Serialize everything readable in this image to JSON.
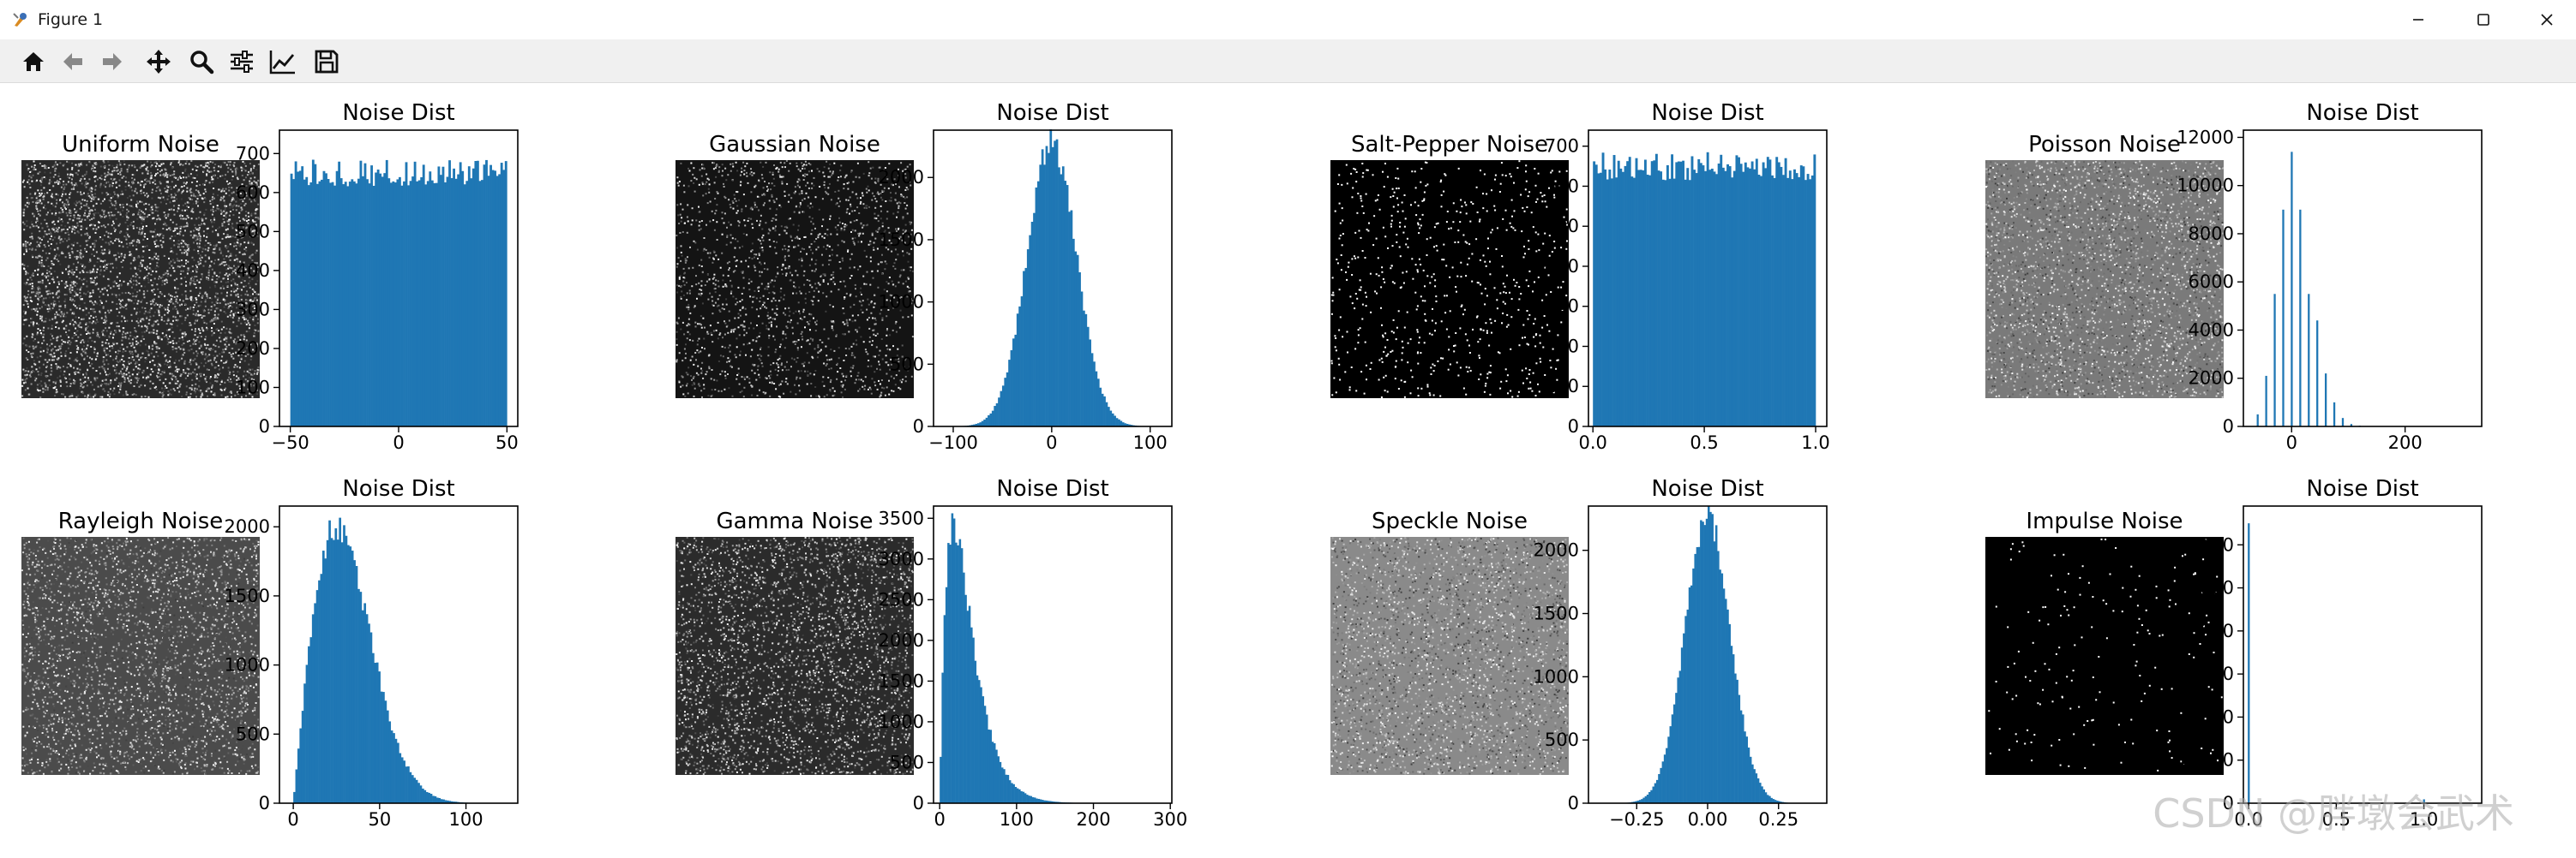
{
  "window": {
    "title": "Figure 1",
    "minimize_icon": "minimize-icon",
    "maximize_icon": "maximize-icon",
    "close_icon": "close-icon"
  },
  "toolbar": {
    "tools": [
      {
        "name": "home-icon"
      },
      {
        "name": "back-arrow-icon"
      },
      {
        "name": "forward-arrow-icon"
      },
      {
        "name": "pan-move-icon"
      },
      {
        "name": "zoom-icon"
      },
      {
        "name": "configure-subplots-icon"
      },
      {
        "name": "edit-axis-icon"
      },
      {
        "name": "save-icon"
      }
    ]
  },
  "colors": {
    "bar": "#1f77b4"
  },
  "watermark": "CSDN @胖墩会武术",
  "chart_data": [
    {
      "type": "image",
      "title": "Uniform Noise",
      "intensity": "mixed-black-white"
    },
    {
      "type": "bar",
      "title": "Noise Dist",
      "x_ticks": [
        "−50",
        "0",
        "50"
      ],
      "y_ticks": [
        "0",
        "100",
        "200",
        "300",
        "400",
        "500",
        "600",
        "700"
      ],
      "xlim": [
        -55,
        55
      ],
      "ylim": [
        0,
        760
      ],
      "series": [
        {
          "shape": "uniform",
          "x_range": [
            -50,
            50
          ],
          "mean_height": 650,
          "noise": 35
        }
      ]
    },
    {
      "type": "image",
      "title": "Gaussian Noise",
      "intensity": "dark-sparse"
    },
    {
      "type": "bar",
      "title": "Noise Dist",
      "x_ticks": [
        "−100",
        "0",
        "100"
      ],
      "y_ticks": [
        "0",
        "500",
        "1000",
        "1500",
        "2000"
      ],
      "xlim": [
        -120,
        122
      ],
      "ylim": [
        0,
        2380
      ],
      "series": [
        {
          "shape": "gaussian",
          "mean": 0,
          "sd": 25,
          "peak": 2280
        }
      ]
    },
    {
      "type": "image",
      "title": "Salt-Pepper Noise",
      "intensity": "black-sparse-white"
    },
    {
      "type": "bar",
      "title": "Noise Dist",
      "x_ticks": [
        "0.0",
        "0.5",
        "1.0"
      ],
      "y_ticks": [
        "0",
        "100",
        "200",
        "300",
        "400",
        "500",
        "600",
        "700"
      ],
      "xlim": [
        -0.02,
        1.05
      ],
      "ylim": [
        0,
        740
      ],
      "series": [
        {
          "shape": "uniform",
          "x_range": [
            0,
            1
          ],
          "mean_height": 650,
          "noise": 35
        }
      ]
    },
    {
      "type": "image",
      "title": "Poisson Noise",
      "intensity": "gray-dense"
    },
    {
      "type": "bar",
      "title": "Noise Dist",
      "x_ticks": [
        "0",
        "200"
      ],
      "y_ticks": [
        "0",
        "2000",
        "4000",
        "6000",
        "8000",
        "10000",
        "12000"
      ],
      "xlim": [
        -85,
        335
      ],
      "ylim": [
        0,
        12300
      ],
      "series": [
        {
          "shape": "spikes",
          "x": [
            -60,
            -45,
            -30,
            -15,
            0,
            15,
            30,
            45,
            60,
            75,
            90,
            105,
            120
          ],
          "values": [
            500,
            2100,
            5500,
            9000,
            11400,
            9000,
            5500,
            4400,
            2200,
            1000,
            350,
            100,
            30
          ]
        }
      ]
    },
    {
      "type": "image",
      "title": "Rayleigh Noise",
      "intensity": "gray-dark"
    },
    {
      "type": "bar",
      "title": "Noise Dist",
      "x_ticks": [
        "0",
        "50",
        "100"
      ],
      "y_ticks": [
        "0",
        "500",
        "1000",
        "1500",
        "2000"
      ],
      "xlim": [
        -8,
        130
      ],
      "ylim": [
        0,
        2150
      ],
      "series": [
        {
          "shape": "rayleigh",
          "sigma": 25,
          "peak": 2000,
          "x_range": [
            0,
            120
          ]
        }
      ]
    },
    {
      "type": "image",
      "title": "Gamma Noise",
      "intensity": "dark-dense"
    },
    {
      "type": "bar",
      "title": "Noise Dist",
      "x_ticks": [
        "0",
        "100",
        "200",
        "300"
      ],
      "y_ticks": [
        "0",
        "500",
        "1000",
        "1500",
        "2000",
        "2500",
        "3000",
        "3500"
      ],
      "xlim": [
        -8,
        302
      ],
      "ylim": [
        0,
        3650
      ],
      "series": [
        {
          "shape": "gamma",
          "k": 2,
          "theta": 18,
          "peak": 3400,
          "x_range": [
            0,
            250
          ]
        }
      ]
    },
    {
      "type": "image",
      "title": "Speckle Noise",
      "intensity": "gray-mid"
    },
    {
      "type": "bar",
      "title": "Noise Dist",
      "x_ticks": [
        "−0.25",
        "0.00",
        "0.25"
      ],
      "y_ticks": [
        "0",
        "500",
        "1000",
        "1500",
        "2000"
      ],
      "xlim": [
        -0.42,
        0.42
      ],
      "ylim": [
        0,
        2350
      ],
      "series": [
        {
          "shape": "gaussian",
          "mean": 0,
          "sd": 0.08,
          "peak": 2250
        }
      ]
    },
    {
      "type": "image",
      "title": "Impulse Noise",
      "intensity": "black-very-sparse"
    },
    {
      "type": "bar",
      "title": "Noise Dist",
      "x_ticks": [
        "0.0",
        "0.5",
        "1.0"
      ],
      "y_ticks": [
        "0",
        "10000",
        "20000",
        "30000",
        "40000",
        "50000",
        "60000"
      ],
      "xlim": [
        -0.03,
        1.33
      ],
      "ylim": [
        0,
        69000
      ],
      "series": [
        {
          "shape": "spikes",
          "x": [
            0,
            1
          ],
          "values": [
            65000,
            900
          ]
        }
      ]
    }
  ]
}
